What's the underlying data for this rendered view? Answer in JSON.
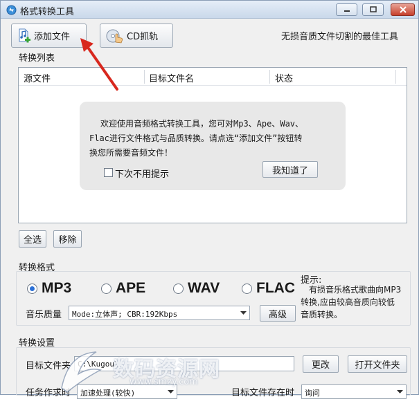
{
  "window": {
    "title": "格式转换工具"
  },
  "toolbar": {
    "add_file_label": "添加文件",
    "cd_rip_label": "CD抓轨",
    "tagline": "无损音质文件切割的最佳工具"
  },
  "convert_list": {
    "section_label": "转换列表",
    "columns": [
      "源文件",
      "目标文件名",
      "状态"
    ]
  },
  "welcome_dialog": {
    "message_line1": "欢迎使用音频格式转换工具，您可对Mp3、Ape、Wav、",
    "message_line2": "Flac进行文件格式与品质转换。请点选“添加文件”按钮转",
    "message_line3": "换您所需要音频文件！",
    "dont_show_label": "下次不用提示",
    "dont_show_checked": false,
    "ok_label": "我知道了"
  },
  "list_actions": {
    "select_all_label": "全选",
    "remove_label": "移除"
  },
  "format": {
    "section_label": "转换格式",
    "options": [
      "MP3",
      "APE",
      "WAV",
      "FLAC"
    ],
    "selected": "MP3",
    "quality_label": "音乐质量",
    "quality_value": "Mode:立体声; CBR:192Kbps",
    "advanced_label": "高级",
    "tip_title": "提示:",
    "tip_line1": "有损音乐格式歌曲向MP3",
    "tip_line2": "转换,应由较高音质向较低",
    "tip_line3": "音质转换。"
  },
  "settings": {
    "section_label": "转换设置",
    "target_folder_label": "目标文件夹",
    "target_folder_value": "C:\\Kugou\\",
    "change_label": "更改",
    "open_folder_label": "打开文件夹",
    "task_mode_label": "任务作求时",
    "task_mode_value": "加速处理(较快)",
    "exists_label": "目标文件存在时",
    "exists_value": "询问"
  },
  "watermark": {
    "text": "数码资源网",
    "url": "www.smzy.com"
  },
  "colors": {
    "accent_blue": "#2a6fd6",
    "arrow_red": "#d8281e",
    "close_red": "#c6402c"
  }
}
